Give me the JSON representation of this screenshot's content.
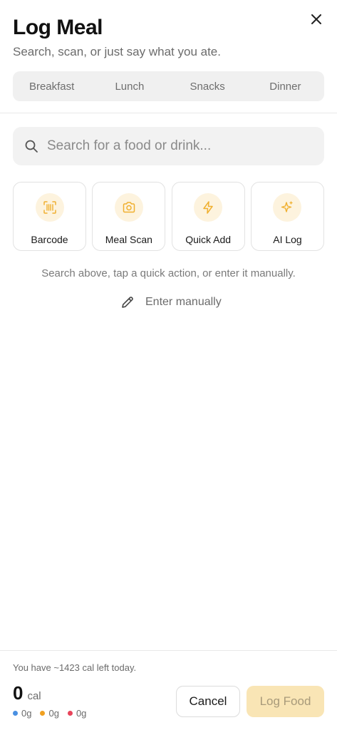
{
  "header": {
    "title": "Log Meal",
    "subtitle": "Search, scan, or just say what you ate.",
    "close_icon": "close-icon"
  },
  "meal_tabs": [
    {
      "label": "Breakfast"
    },
    {
      "label": "Lunch"
    },
    {
      "label": "Snacks"
    },
    {
      "label": "Dinner"
    }
  ],
  "search": {
    "placeholder": "Search for a food or drink...",
    "value": "",
    "icon": "search-icon"
  },
  "quick_actions": [
    {
      "label": "Barcode",
      "icon": "barcode-icon"
    },
    {
      "label": "Meal Scan",
      "icon": "camera-icon"
    },
    {
      "label": "Quick Add",
      "icon": "lightning-icon"
    },
    {
      "label": "AI Log",
      "icon": "sparkles-icon"
    }
  ],
  "hint": "Search above, tap a quick action, or enter it manually.",
  "manual_entry": {
    "label": "Enter manually",
    "icon": "pencil-icon"
  },
  "footer": {
    "calories_left": "You have ~1423 cal left today.",
    "calories_value": "0",
    "calories_unit": "cal",
    "macros": [
      {
        "value": "0g",
        "color": "#4a90e2"
      },
      {
        "value": "0g",
        "color": "#f0a020"
      },
      {
        "value": "0g",
        "color": "#e8445a"
      }
    ],
    "cancel_label": "Cancel",
    "log_label": "Log Food"
  },
  "colors": {
    "accent": "#f5b93a",
    "accent_soft": "#fdf3de",
    "log_button_disabled": "#f9e5b5"
  }
}
